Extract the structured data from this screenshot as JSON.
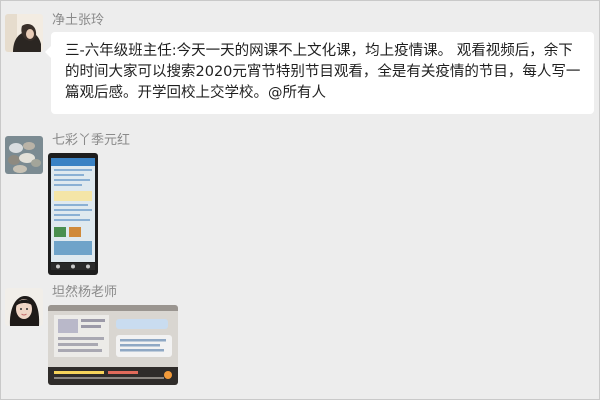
{
  "messages": [
    {
      "sender": "净土张玲",
      "type": "text",
      "text": "三-六年级班主任:今天一天的网课不上文化课，均上疫情课。 观看视频后，余下的时间大家可以搜索2020元宵节特别节目观看，全是有关疫情的节目，每人写一篇观后感。开学回校上交学校。@所有人"
    },
    {
      "sender": "七彩丫季元红",
      "type": "image",
      "image_desc": "phone-screenshot-thumbnail"
    },
    {
      "sender": "坦然杨老师",
      "type": "image",
      "image_desc": "video-lesson-thumbnail"
    }
  ],
  "colors": {
    "background": "#ededed",
    "bubble": "#ffffff",
    "sender_name": "#8a8a8a",
    "text": "#1f1f1f"
  }
}
